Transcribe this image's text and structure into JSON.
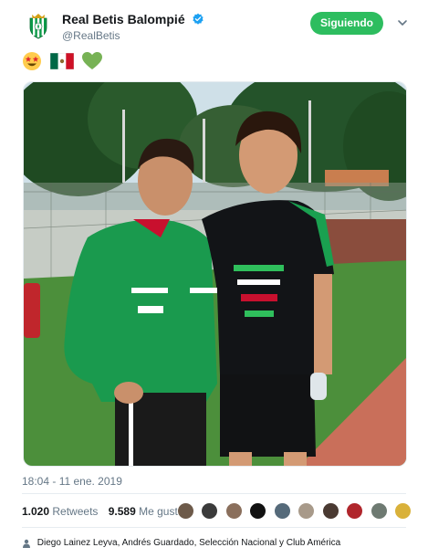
{
  "account": {
    "display_name": "Real Betis Balompié",
    "handle": "@RealBetis",
    "verified": true,
    "avatar_icon": "real-betis-crest-icon"
  },
  "actions": {
    "follow_label": "Siguiendo",
    "follow_color": "#2dbd5f",
    "more_icon": "chevron-down-icon"
  },
  "tweet": {
    "emojis": [
      "star-struck-face",
      "mexico-flag",
      "green-heart"
    ]
  },
  "timestamp": "18:04 - 11 ene. 2019",
  "stats": {
    "retweets_count": "1.020",
    "retweets_label": "Retweets",
    "likes_count": "9.589",
    "likes_label": "Me gusta"
  },
  "likers_count_shown": 10,
  "tagged": {
    "icon": "person-tag-icon",
    "text": "Diego Lainez Leyva, Andrés Guardado, Selección Nacional y Club América"
  },
  "colors": {
    "text_primary": "#14171a",
    "text_secondary": "#657786",
    "verified_blue": "#1da1f2",
    "divider": "#e6ecf0"
  }
}
